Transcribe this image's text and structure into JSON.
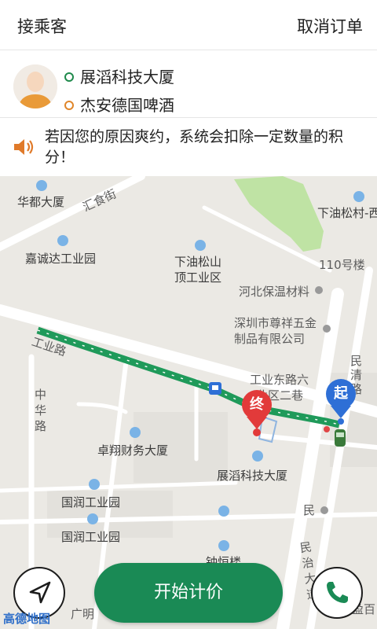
{
  "header": {
    "title": "接乘客",
    "cancel_label": "取消订单"
  },
  "trip": {
    "pickup": "展滔科技大厦",
    "dropoff": "杰安德国啤酒"
  },
  "notice": {
    "text": "若因您的原因爽约，系统会扣除一定数量的积分！"
  },
  "map": {
    "labels": {
      "huadu": "华都大厦",
      "huishi": "汇食街",
      "xiayou_cun": "下油松村-西",
      "jiacheng": "嘉诚达工业园",
      "xiayou_shan_1": "下油松山",
      "xiayou_shan_2": "顶工业区",
      "bld110": "110号楼",
      "hebei": "河北保温材料",
      "zunxiang_1": "深圳市尊祥五金",
      "zunxiang_2": "制品有限公司",
      "gongye_road": "工业路",
      "gyd_1": "工业东路六",
      "gyd_2": "业区二巷",
      "minqing": "民清路",
      "zhonghua": "中华路",
      "zhuoxiang": "卓翔财务大厦",
      "zhantao": "展滔科技大厦",
      "guorun1": "国润工业园",
      "guorun2": "国润工业园",
      "zhongheng": "钟恒楼",
      "minzhi": "民治大道",
      "min": "民",
      "guangming": "广明",
      "yingbai": "盈百"
    },
    "start_pin": "起",
    "end_pin": "终",
    "logo": "高德地图",
    "route_color": "#1f9a5a"
  },
  "actions": {
    "start_label": "开始计价"
  },
  "colors": {
    "accent": "#1a8a55",
    "start_pin": "#2e6fd6",
    "end_pin": "#e23a3a"
  }
}
